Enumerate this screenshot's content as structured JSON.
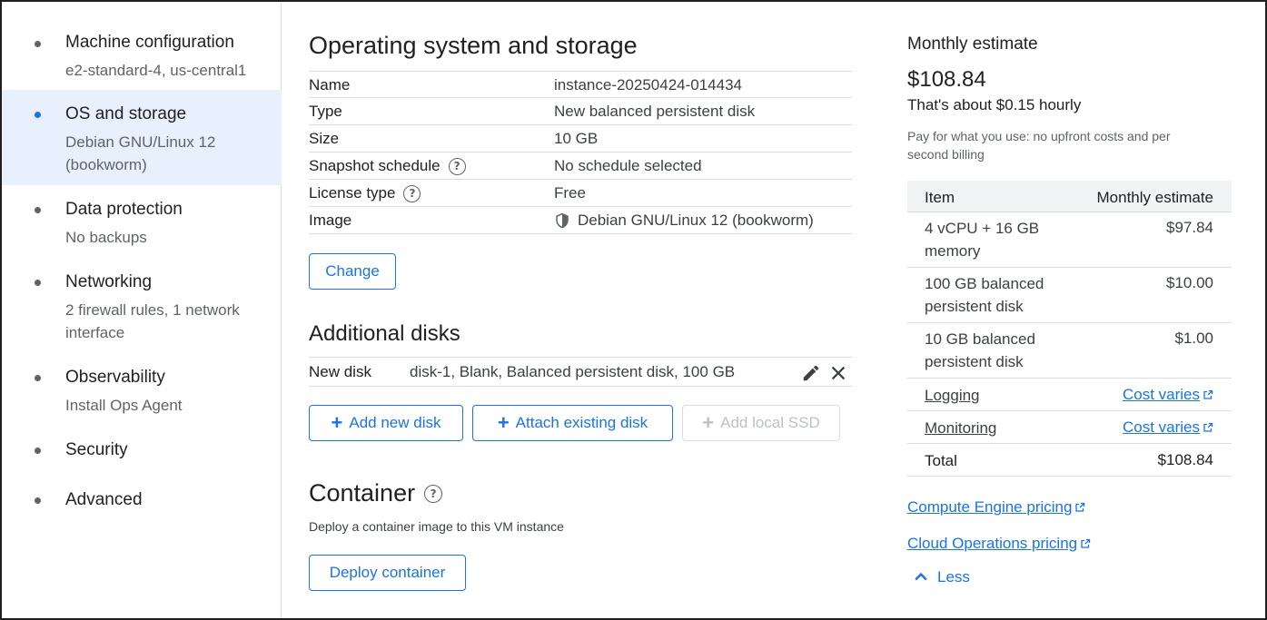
{
  "sidebar": {
    "steps": [
      {
        "title": "Machine configuration",
        "subtitle": "e2-standard-4, us-central1"
      },
      {
        "title": "OS and storage",
        "subtitle": "Debian GNU/Linux 12 (bookworm)"
      },
      {
        "title": "Data protection",
        "subtitle": "No backups"
      },
      {
        "title": "Networking",
        "subtitle": "2 firewall rules, 1 network interface"
      },
      {
        "title": "Observability",
        "subtitle": "Install Ops Agent"
      },
      {
        "title": "Security",
        "subtitle": ""
      },
      {
        "title": "Advanced",
        "subtitle": ""
      }
    ]
  },
  "os_storage": {
    "heading": "Operating system and storage",
    "rows": [
      {
        "key": "Name",
        "value": "instance-20250424-014434"
      },
      {
        "key": "Type",
        "value": "New balanced persistent disk"
      },
      {
        "key": "Size",
        "value": "10 GB"
      },
      {
        "key": "Snapshot schedule",
        "value": "No schedule selected"
      },
      {
        "key": "License type",
        "value": "Free"
      },
      {
        "key": "Image",
        "value": "Debian GNU/Linux 12 (bookworm)"
      }
    ],
    "change_label": "Change"
  },
  "additional_disks": {
    "heading": "Additional disks",
    "disk_key": "New disk",
    "disk_value": "disk-1, Blank, Balanced persistent disk, 100 GB",
    "add_new_label": "Add new disk",
    "attach_label": "Attach existing disk",
    "add_ssd_label": "Add local SSD"
  },
  "container": {
    "heading": "Container",
    "description": "Deploy a container image to this VM instance",
    "deploy_label": "Deploy container"
  },
  "estimate": {
    "title": "Monthly estimate",
    "total": "$108.84",
    "hourly": "That's about $0.15 hourly",
    "note": "Pay for what you use: no upfront costs and per second billing",
    "col_item": "Item",
    "col_estimate": "Monthly estimate",
    "items": [
      {
        "item": "4 vCPU + 16 GB memory",
        "price": "$97.84"
      },
      {
        "item": "100 GB balanced persistent disk",
        "price": "$10.00"
      },
      {
        "item": "10 GB balanced persistent disk",
        "price": "$1.00"
      }
    ],
    "logging": {
      "item": "Logging",
      "price": "Cost varies"
    },
    "monitoring": {
      "item": "Monitoring",
      "price": "Cost varies"
    },
    "total_label": "Total",
    "total_value": "$108.84",
    "compute_pricing": "Compute Engine pricing",
    "ops_pricing": "Cloud Operations pricing",
    "less_label": "Less"
  },
  "colors": {
    "accent": "#1a73e8",
    "active_bg": "#e8f0fe",
    "divider": "#dadce0"
  }
}
